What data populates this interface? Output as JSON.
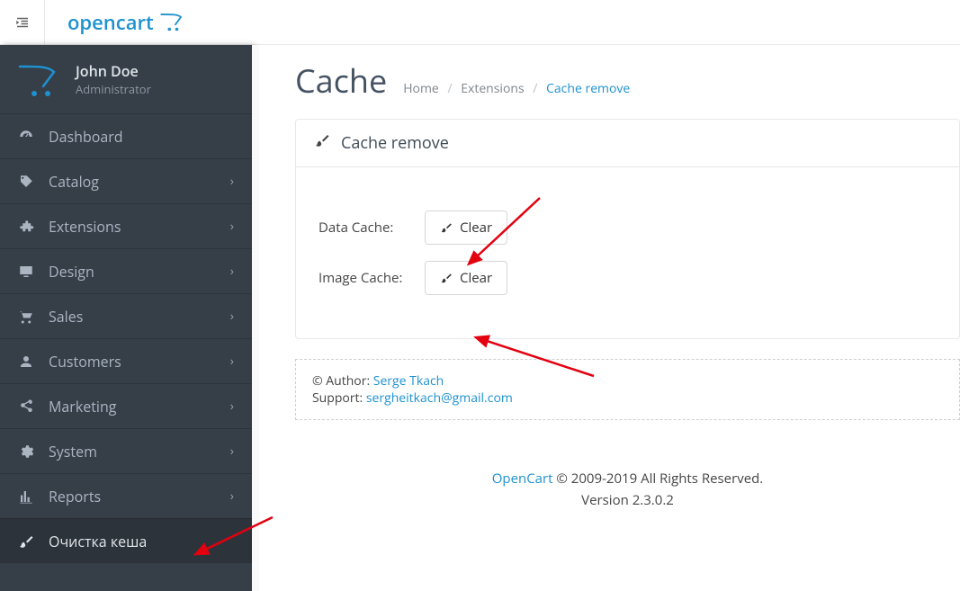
{
  "header": {
    "brand_name": "opencart"
  },
  "user": {
    "name": "John Doe",
    "role": "Administrator"
  },
  "nav": {
    "items": [
      {
        "icon": "dashboard",
        "label": "Dashboard",
        "has_children": false
      },
      {
        "icon": "tag",
        "label": "Catalog",
        "has_children": true
      },
      {
        "icon": "puzzle",
        "label": "Extensions",
        "has_children": true
      },
      {
        "icon": "desktop",
        "label": "Design",
        "has_children": true
      },
      {
        "icon": "cart",
        "label": "Sales",
        "has_children": true
      },
      {
        "icon": "user",
        "label": "Customers",
        "has_children": true
      },
      {
        "icon": "share",
        "label": "Marketing",
        "has_children": true
      },
      {
        "icon": "gear",
        "label": "System",
        "has_children": true
      },
      {
        "icon": "bars",
        "label": "Reports",
        "has_children": true
      },
      {
        "icon": "brush",
        "label": "Очистка кеша",
        "has_children": false,
        "active": true
      }
    ]
  },
  "page": {
    "title": "Cache",
    "breadcrumbs": {
      "home": "Home",
      "extensions": "Extensions",
      "current": "Cache remove"
    },
    "panel_title": "Cache remove",
    "rows": [
      {
        "label": "Data Cache:",
        "button": "Clear"
      },
      {
        "label": "Image Cache:",
        "button": "Clear"
      }
    ],
    "author": {
      "prefix": "© Author: ",
      "name": "Serge Tkach",
      "support_prefix": "Support: ",
      "support_email": "sergheitkach@gmail.com"
    }
  },
  "footer": {
    "link": "OpenCart",
    "copyright": " © 2009-2019 All Rights Reserved.",
    "version": "Version 2.3.0.2"
  },
  "annotations": {
    "arrows": [
      {
        "target": "clear-data-cache"
      },
      {
        "target": "clear-image-cache"
      },
      {
        "target": "nav-cache-clear"
      }
    ]
  }
}
